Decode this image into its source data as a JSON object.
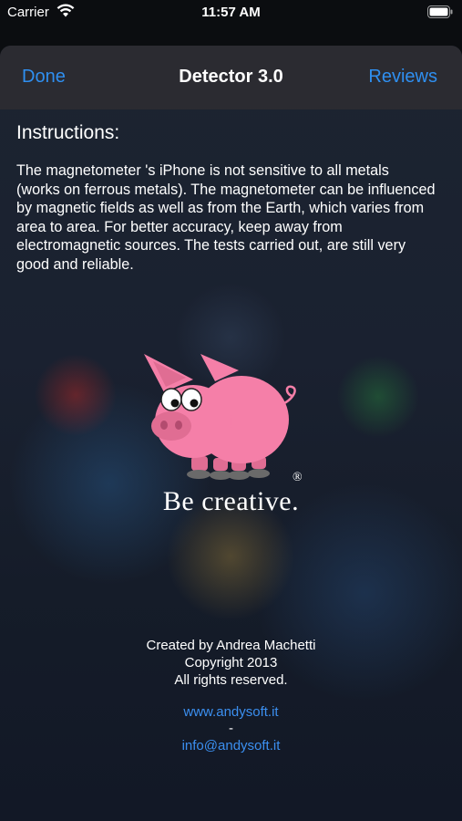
{
  "status_bar": {
    "carrier": "Carrier",
    "time": "11:57 AM",
    "icons": [
      "wifi-icon",
      "battery-icon"
    ]
  },
  "navbar": {
    "done_label": "Done",
    "title": "Detector 3.0",
    "reviews_label": "Reviews"
  },
  "instructions": {
    "title": "Instructions:",
    "body": "The magnetometer 's iPhone is not sensitive to all metals (works on ferrous metals). The magnetometer can be influenced by magnetic fields as well as from the Earth, which varies from area to area. For better accuracy, keep away from electromagnetic sources. The tests carried out, are still very good and reliable."
  },
  "logo": {
    "icon": "pig-logo",
    "slogan": "Be creative.",
    "registered_mark": "®"
  },
  "footer": {
    "created_by": "Created by Andrea Machetti",
    "copyright": "Copyright 2013",
    "rights": "All rights reserved.",
    "website": "www.andysoft.it",
    "separator": "-",
    "email": "info@andysoft.it"
  },
  "colors": {
    "accent": "#2f8ff0",
    "navbar_bg": "#2c2c32",
    "pig_pink": "#f57fa8"
  }
}
